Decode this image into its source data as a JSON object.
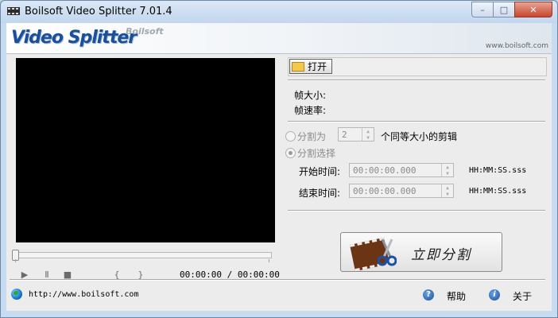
{
  "window": {
    "title": "Boilsoft Video Splitter 7.01.4",
    "controls": {
      "minimize": "–",
      "maximize": "□",
      "close": "✕"
    }
  },
  "banner": {
    "logo": "Video Splitter",
    "brand": "Boilsoft",
    "url": "www.boilsoft.com"
  },
  "player": {
    "buttons": {
      "play": "▶",
      "pause": "Ⅱ",
      "stop": "■",
      "prev": "{",
      "next": "}"
    },
    "time": "00:00:00 / 00:00:00",
    "progress": 0
  },
  "footer": {
    "url": "http://www.boilsoft.com",
    "help": "帮助",
    "about": "关于"
  },
  "file": {
    "open_label": "打开",
    "frame_size_label": "帧大小:",
    "frame_rate_label": "帧速率:"
  },
  "split": {
    "split_into_label": "分割为",
    "split_into_value": "2",
    "split_into_suffix": "个同等大小的剪辑",
    "select_label": "分割选择",
    "start_label": "开始时间:",
    "start_value": "00:00:00.000",
    "end_label": "结束时间:",
    "end_value": "00:00:00.000",
    "format_hint": "HH:MM:SS.sss",
    "selected_mode": "分割选择"
  },
  "action": {
    "split_now": "立即分割"
  },
  "icons": [
    "app-icon",
    "folder-icon",
    "globe-icon",
    "help-icon",
    "info-icon",
    "film-icon",
    "scissors-icon"
  ]
}
